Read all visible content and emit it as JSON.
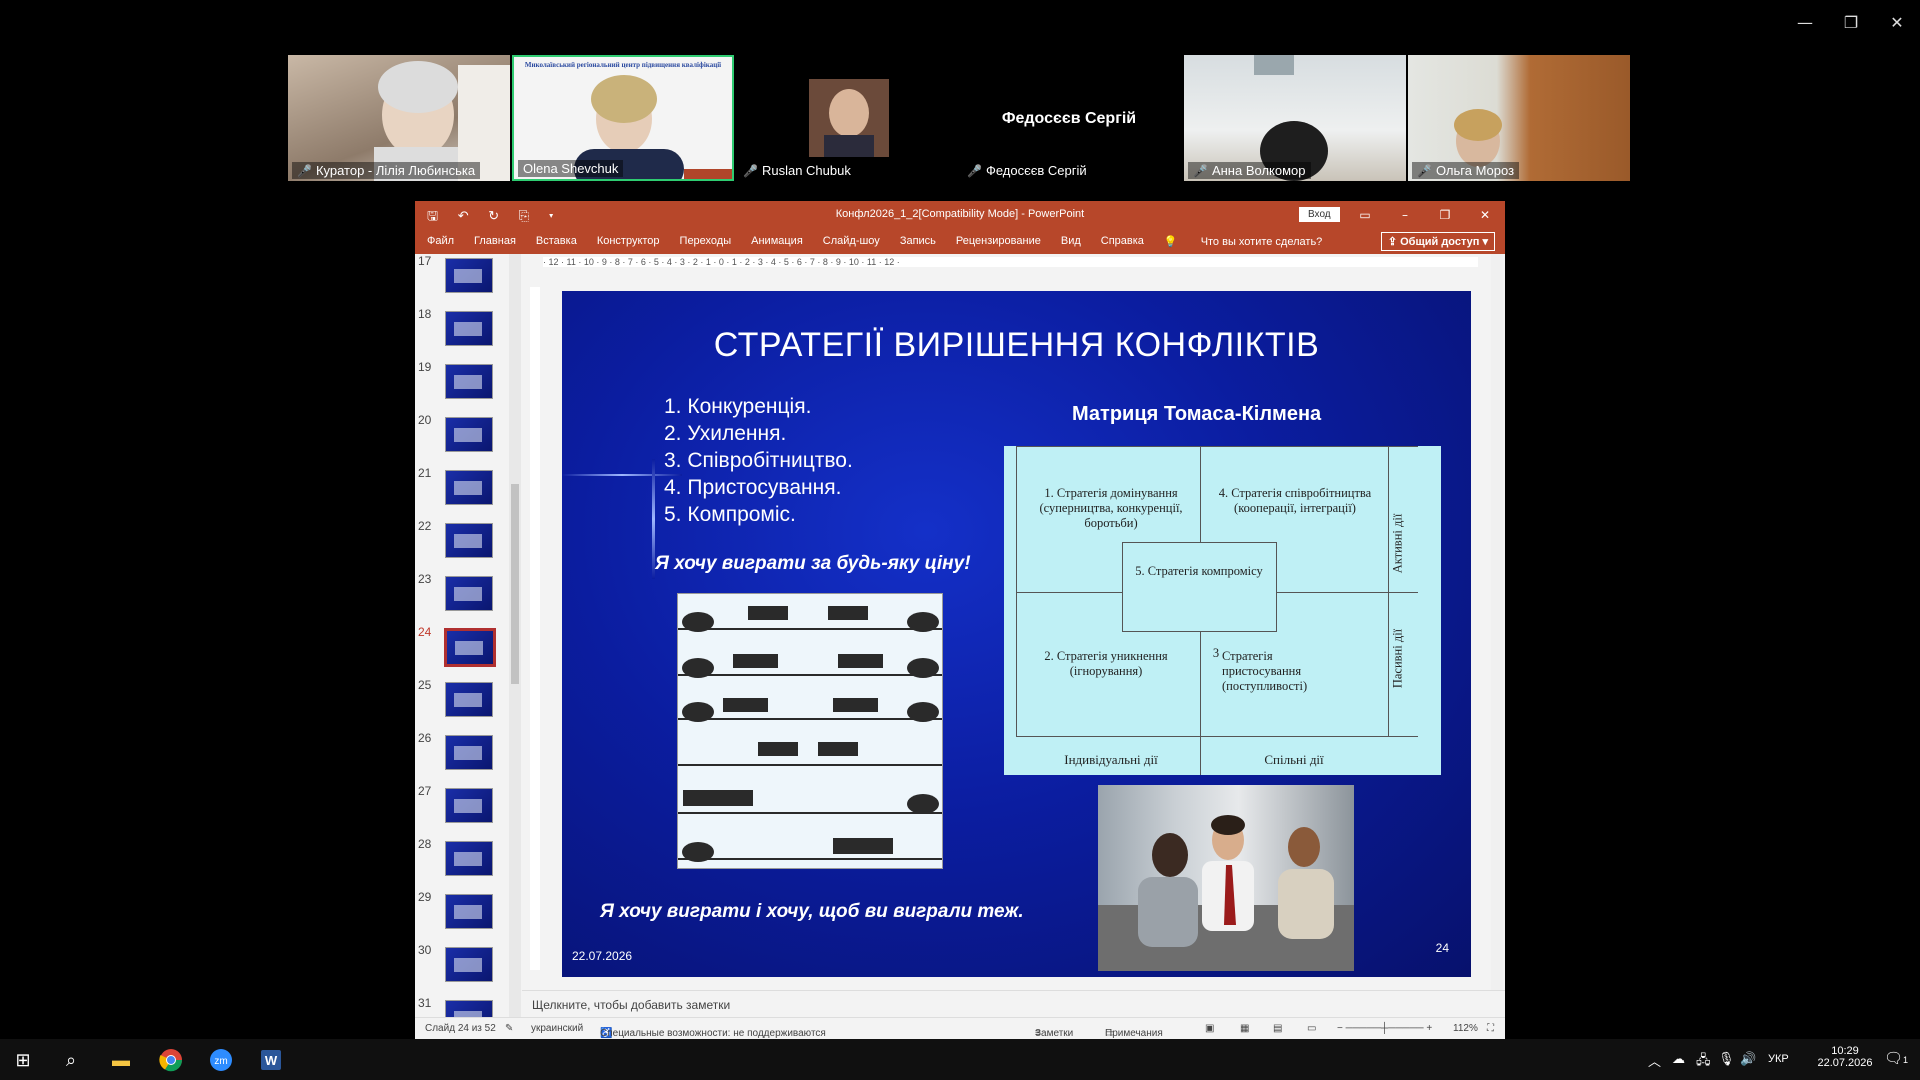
{
  "window_controls": {
    "minimize": "—",
    "restore": "❐",
    "close": "✕"
  },
  "participants": [
    {
      "name": "Куратор - Лілія Любинська"
    },
    {
      "name": "Olena Shevchuk",
      "banner": "Миколаївський регіональний центр підвищення кваліфікації"
    },
    {
      "name": "Ruslan Chubuk"
    },
    {
      "name": "Федосєєв Сергій",
      "big_name": "Федосєєв Сергій"
    },
    {
      "name": "Анна Волкомор"
    },
    {
      "name": "Ольга Мороз"
    }
  ],
  "ppt": {
    "title": "Конфл2026_1_2[Compatibility Mode]  -  PowerPoint",
    "quick_access": "🖫 ↶ ↻ ⎘ ▾",
    "signin": "Вход",
    "tabs": [
      "Файл",
      "Главная",
      "Вставка",
      "Конструктор",
      "Переходы",
      "Анимация",
      "Слайд-шоу",
      "Запись",
      "Рецензирование",
      "Вид",
      "Справка"
    ],
    "tell_me": "Что вы хотите сделать?",
    "share": "Общий доступ",
    "ruler_h": "· 12 · 11 · 10 · 9 · 8 · 7 · 6 · 5 · 4 · 3 · 2 · 1 · 0 · 1 · 2 · 3 · 4 · 5 · 6 · 7 · 8 · 9 · 10 · 11 · 12 ·",
    "thumbnails": [
      {
        "num": "17"
      },
      {
        "num": "18"
      },
      {
        "num": "19"
      },
      {
        "num": "20"
      },
      {
        "num": "21"
      },
      {
        "num": "22"
      },
      {
        "num": "23"
      },
      {
        "num": "24",
        "active": true
      },
      {
        "num": "25"
      },
      {
        "num": "26"
      },
      {
        "num": "27"
      },
      {
        "num": "28"
      },
      {
        "num": "29"
      },
      {
        "num": "30"
      },
      {
        "num": "31"
      }
    ],
    "notes_placeholder": "Щелкните, чтобы добавить заметки",
    "status": {
      "slide": "Слайд 24 из 52",
      "lang": "украинский",
      "accessibility": "Специальные возможности: не поддерживаются",
      "notes": "Заметки",
      "comments": "Примечания",
      "zoom": "112%"
    }
  },
  "slide": {
    "title": "СТРАТЕГІЇ ВИРІШЕННЯ КОНФЛІКТІВ",
    "list": [
      "1. Конкуренція.",
      "2. Ухилення.",
      "3. Співробітництво.",
      "4. Пристосування.",
      "5. Компроміс."
    ],
    "quote1": "Я хочу виграти за будь-яку ціну!",
    "quote2": "Я хочу виграти і хочу, щоб ви виграли теж.",
    "matrix_title": "Матриця Томаса-Кілмена",
    "matrix": {
      "cell1": "1. Стратегія домінування (суперництва, конкуренції, боротьби)",
      "cell4": "4. Стратегія співробітництва (кооперації, інтеграції)",
      "cell5": "5. Стратегія компромісу",
      "cell2": "2. Стратегія уникнення (ігнорування)",
      "cell3_num": "3",
      "cell3": "Стратегія пристосування (поступливості)",
      "active": "Активні дії",
      "passive": "Пасивні дії",
      "individual": "Індивідуальні дії",
      "joint": "Спільні дії"
    },
    "date": "22.07.2026",
    "number": "24"
  },
  "taskbar": {
    "lang": "УКР",
    "time": "10:29",
    "date": "22.07.2026",
    "notifications": "1"
  }
}
